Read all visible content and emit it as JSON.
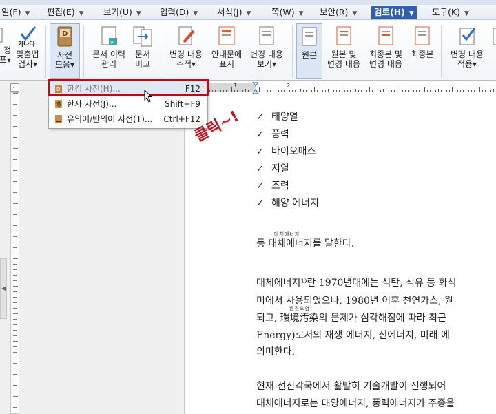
{
  "menu": {
    "items": [
      {
        "label": "일(F)",
        "active": false
      },
      {
        "label": "편집(E)",
        "active": false
      },
      {
        "label": "보기(U)",
        "active": false
      },
      {
        "label": "입력(D)",
        "active": false
      },
      {
        "label": "서식(J)",
        "active": false
      },
      {
        "label": "쪽(W)",
        "active": false
      },
      {
        "label": "보안(R)",
        "active": false
      },
      {
        "label": "검토(H)",
        "active": true
      },
      {
        "label": "도구(K)",
        "active": false
      }
    ]
  },
  "ribbon": {
    "partial_left": "정\n포▾",
    "spellcheck": "맞춤법\n검사▾",
    "dictionary": "사전\n모음▾",
    "doc_history": "문서 이력\n관리",
    "doc_compare": "문서\n비교",
    "track_changes": "변경 내용\n추적▾",
    "show_guide": "안내문에\n표시",
    "view_changes": "변경 내용\n보기▾",
    "original": "원본",
    "original_and_changes": "원본 및\n변경 내용",
    "final_and_changes": "최종본 및\n변경 내용",
    "final": "최종본",
    "apply_changes": "변경 내용\n적용▾",
    "spell_icon_text": "가나다"
  },
  "dropdown": {
    "items": [
      {
        "label": "한컴 사전(H)...",
        "shortcut": "F12",
        "highlighted": true
      },
      {
        "label": "한자 자전(J)...",
        "shortcut": "Shift+F9",
        "highlighted": false
      },
      {
        "label": "유의어/반의어 사전(T)...",
        "shortcut": "Ctrl+F12",
        "highlighted": false
      }
    ]
  },
  "annotation": "클릭~!",
  "ruler": {
    "numbers": [
      "1",
      "2"
    ]
  },
  "document": {
    "bullets": [
      "태양열",
      "풍력",
      "바이오매스",
      "지열",
      "조력",
      "해양 에너지"
    ],
    "line1": "등 대체에너지를 말한다.",
    "line1_ruby": "대체에너지",
    "para2": [
      "대체에너지¹⁾란 1970년대에는 석탄, 석유 등 화석",
      "미에서 사용되었으나, 1980년 이후 천연가스, 원",
      "되고, 環境汚染의 문제가 심각해짐에 따라 최근",
      "Energy)로서의 재생 에너지, 신에너지, 미래 에",
      "의미한다."
    ],
    "para2_ruby": "환경오염",
    "para3": [
      "현재 선진각국에서 활발히 기술개발이 진행되어",
      "대체에너지로는 태양에너지, 풍력에너지가 주종을"
    ]
  }
}
